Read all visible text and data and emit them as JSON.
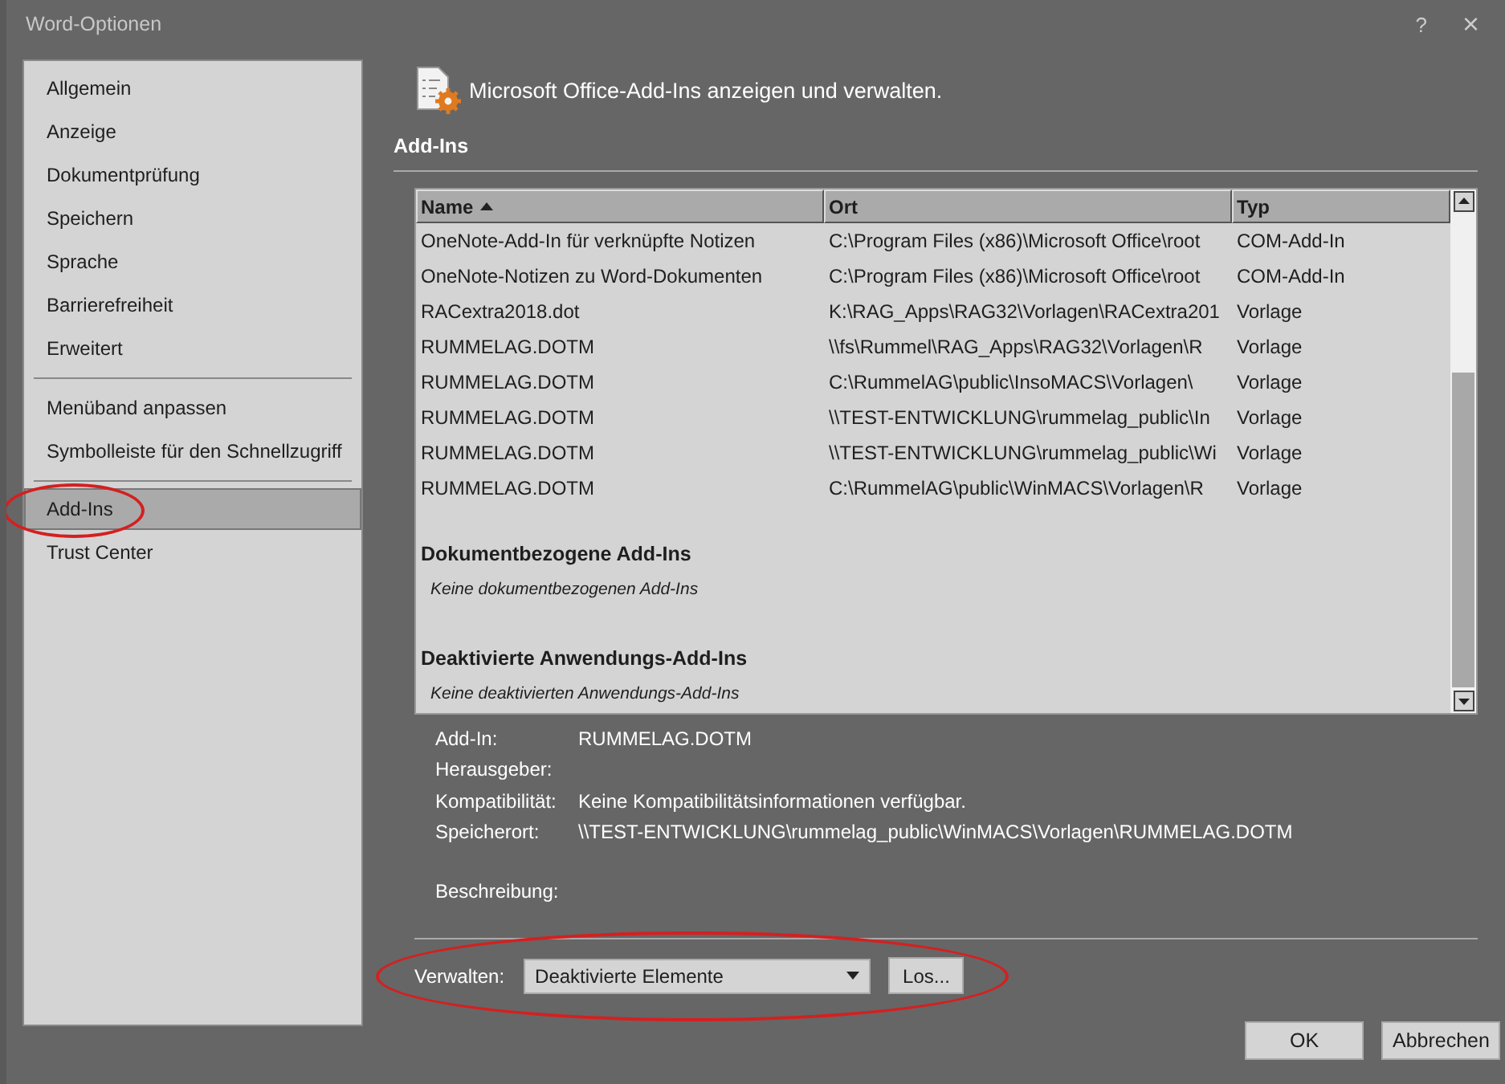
{
  "window": {
    "title": "Word-Optionen",
    "help": "?",
    "close": "×"
  },
  "sidebar": {
    "groups": [
      [
        {
          "label": "Allgemein",
          "selected": false,
          "circled": false
        },
        {
          "label": "Anzeige",
          "selected": false,
          "circled": false
        },
        {
          "label": "Dokumentprüfung",
          "selected": false,
          "circled": false
        },
        {
          "label": "Speichern",
          "selected": false,
          "circled": false
        },
        {
          "label": "Sprache",
          "selected": false,
          "circled": false
        },
        {
          "label": "Barrierefreiheit",
          "selected": false,
          "circled": false
        },
        {
          "label": "Erweitert",
          "selected": false,
          "circled": false
        }
      ],
      [
        {
          "label": "Menüband anpassen",
          "selected": false,
          "circled": false
        },
        {
          "label": "Symbolleiste für den Schnellzugriff",
          "selected": false,
          "circled": false
        }
      ],
      [
        {
          "label": "Add-Ins",
          "selected": true,
          "circled": true
        },
        {
          "label": "Trust Center",
          "selected": false,
          "circled": false
        }
      ]
    ]
  },
  "header": "Microsoft Office-Add-Ins anzeigen und verwalten.",
  "section_title": "Add-Ins",
  "table": {
    "columns": [
      {
        "label": "Name",
        "sorted": true
      },
      {
        "label": "Ort",
        "sorted": false
      },
      {
        "label": "Typ",
        "sorted": false
      }
    ],
    "rows": [
      [
        "OneNote-Add-In für verknüpfte Notizen",
        "C:\\Program Files (x86)\\Microsoft Office\\root",
        "COM-Add-In"
      ],
      [
        "OneNote-Notizen zu Word-Dokumenten",
        "C:\\Program Files (x86)\\Microsoft Office\\root",
        "COM-Add-In"
      ],
      [
        "RACextra2018.dot",
        "K:\\RAG_Apps\\RAG32\\Vorlagen\\RACextra201",
        "Vorlage"
      ],
      [
        "RUMMELAG.DOTM",
        "\\\\fs\\Rummel\\RAG_Apps\\RAG32\\Vorlagen\\R",
        "Vorlage"
      ],
      [
        "RUMMELAG.DOTM",
        "C:\\RummelAG\\public\\InsoMACS\\Vorlagen\\",
        "Vorlage"
      ],
      [
        "RUMMELAG.DOTM",
        "\\\\TEST-ENTWICKLUNG\\rummelag_public\\In",
        "Vorlage"
      ],
      [
        "RUMMELAG.DOTM",
        "\\\\TEST-ENTWICKLUNG\\rummelag_public\\Wi",
        "Vorlage"
      ],
      [
        "RUMMELAG.DOTM",
        "C:\\RummelAG\\public\\WinMACS\\Vorlagen\\R",
        "Vorlage"
      ]
    ],
    "groups": [
      {
        "title": "Dokumentbezogene Add-Ins",
        "note": "Keine dokumentbezogenen Add-Ins"
      },
      {
        "title": "Deaktivierte Anwendungs-Add-Ins",
        "note": "Keine deaktivierten Anwendungs-Add-Ins"
      }
    ]
  },
  "details": [
    {
      "label": "Add-In:",
      "value": "RUMMELAG.DOTM"
    },
    {
      "label": "Herausgeber:"
    },
    {
      "label": "Kompatibilität:",
      "value": "Keine Kompatibilitätsinformationen verfügbar."
    },
    {
      "label": "Speicherort:",
      "value": "\\\\TEST-ENTWICKLUNG\\rummelag_public\\WinMACS\\Vorlagen\\RUMMELAG.DOTM"
    },
    {
      "label": "Beschreibung:",
      "gap": true
    }
  ],
  "manage": {
    "label": "Verwalten:",
    "value": "Deaktivierte Elemente",
    "button": "Los...",
    "circled": true
  },
  "buttons": [
    "OK",
    "Abbrechen"
  ]
}
